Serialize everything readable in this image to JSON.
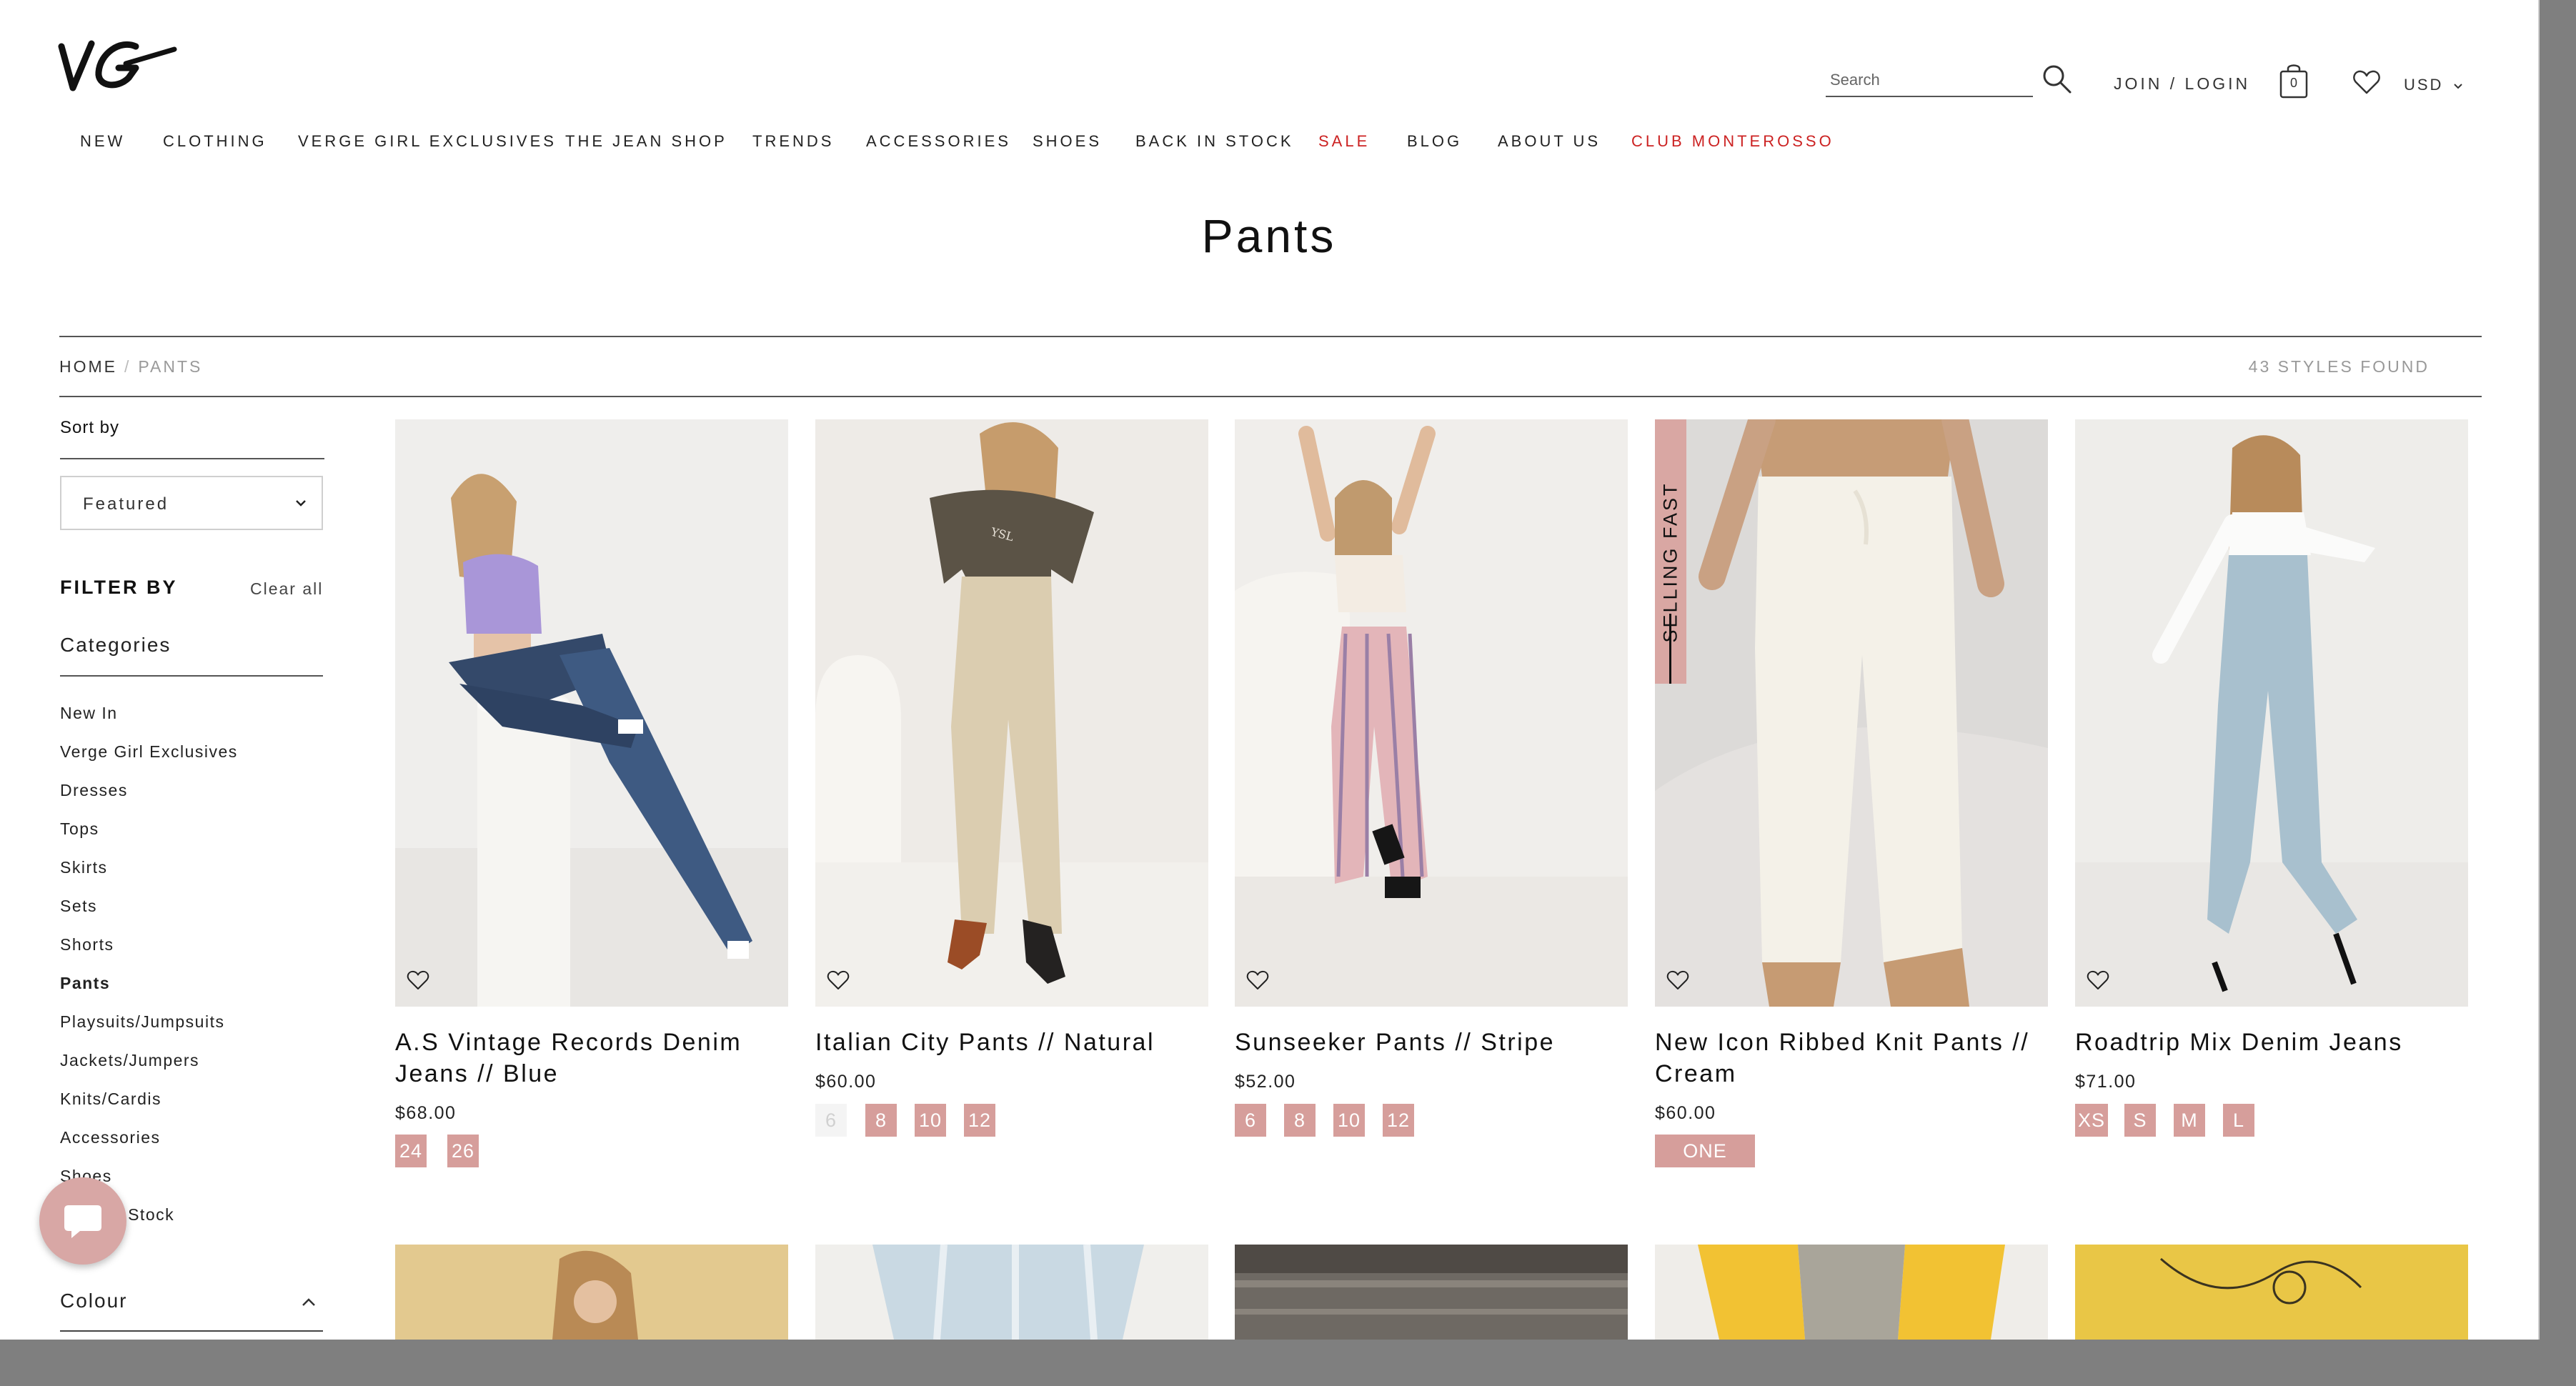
{
  "brand": {
    "logo_text": "VG"
  },
  "header": {
    "search_placeholder": "Search",
    "join_login": "JOIN / LOGIN",
    "bag_count": "0",
    "currency": "USD"
  },
  "nav": [
    {
      "label": "NEW"
    },
    {
      "label": "CLOTHING"
    },
    {
      "label": "VERGE GIRL EXCLUSIVES"
    },
    {
      "label": "THE JEAN SHOP"
    },
    {
      "label": "TRENDS"
    },
    {
      "label": "ACCESSORIES"
    },
    {
      "label": "SHOES"
    },
    {
      "label": "BACK IN STOCK"
    },
    {
      "label": "SALE",
      "highlight": true
    },
    {
      "label": "BLOG"
    },
    {
      "label": "ABOUT US"
    },
    {
      "label": "CLUB MONTEROSSO",
      "highlight": true
    }
  ],
  "page": {
    "title": "Pants",
    "breadcrumb": {
      "home": "HOME",
      "separator": "/",
      "current": "PANTS"
    },
    "styles_found": "43 STYLES FOUND"
  },
  "sidebar": {
    "sort_label": "Sort by",
    "sort_value": "Featured",
    "filter_label": "FILTER BY",
    "clear_all": "Clear all",
    "categories_heading": "Categories",
    "categories": [
      "New In",
      "Verge Girl Exclusives",
      "Dresses",
      "Tops",
      "Skirts",
      "Sets",
      "Shorts",
      "Pants",
      "Playsuits/Jumpsuits",
      "Jackets/Jumpers",
      "Knits/Cardis",
      "Accessories",
      "Shoes",
      "Back In Stock"
    ],
    "colour_heading": "Colour"
  },
  "products": [
    {
      "name": "A.S Vintage Records Denim Jeans // Blue",
      "price": "$68.00",
      "sizes": [
        {
          "label": "24",
          "available": true
        },
        {
          "label": "26",
          "available": true
        }
      ]
    },
    {
      "name": "Italian City Pants // Natural",
      "price": "$60.00",
      "sizes": [
        {
          "label": "6",
          "available": false
        },
        {
          "label": "8",
          "available": true
        },
        {
          "label": "10",
          "available": true
        },
        {
          "label": "12",
          "available": true
        }
      ]
    },
    {
      "name": "Sunseeker Pants // Stripe",
      "price": "$52.00",
      "sizes": [
        {
          "label": "6",
          "available": true
        },
        {
          "label": "8",
          "available": true
        },
        {
          "label": "10",
          "available": true
        },
        {
          "label": "12",
          "available": true
        }
      ]
    },
    {
      "name": "New Icon Ribbed Knit Pants // Cream",
      "price": "$60.00",
      "badge": "SELLING FAST",
      "sizes": [
        {
          "label": "ONE SIZE",
          "available": true
        }
      ]
    },
    {
      "name": "Roadtrip Mix Denim Jeans",
      "price": "$71.00",
      "sizes": [
        {
          "label": "XS",
          "available": true
        },
        {
          "label": "S",
          "available": true
        },
        {
          "label": "M",
          "available": true
        },
        {
          "label": "L",
          "available": true
        }
      ]
    }
  ],
  "colors": {
    "accent_red": "#cc2222",
    "size_pink": "#d69e9b",
    "chat_pink": "#d8a7a5"
  },
  "icons": {
    "search": "search-icon",
    "bag": "shopping-bag-icon",
    "wishlist": "heart-icon",
    "chat": "chat-icon"
  }
}
